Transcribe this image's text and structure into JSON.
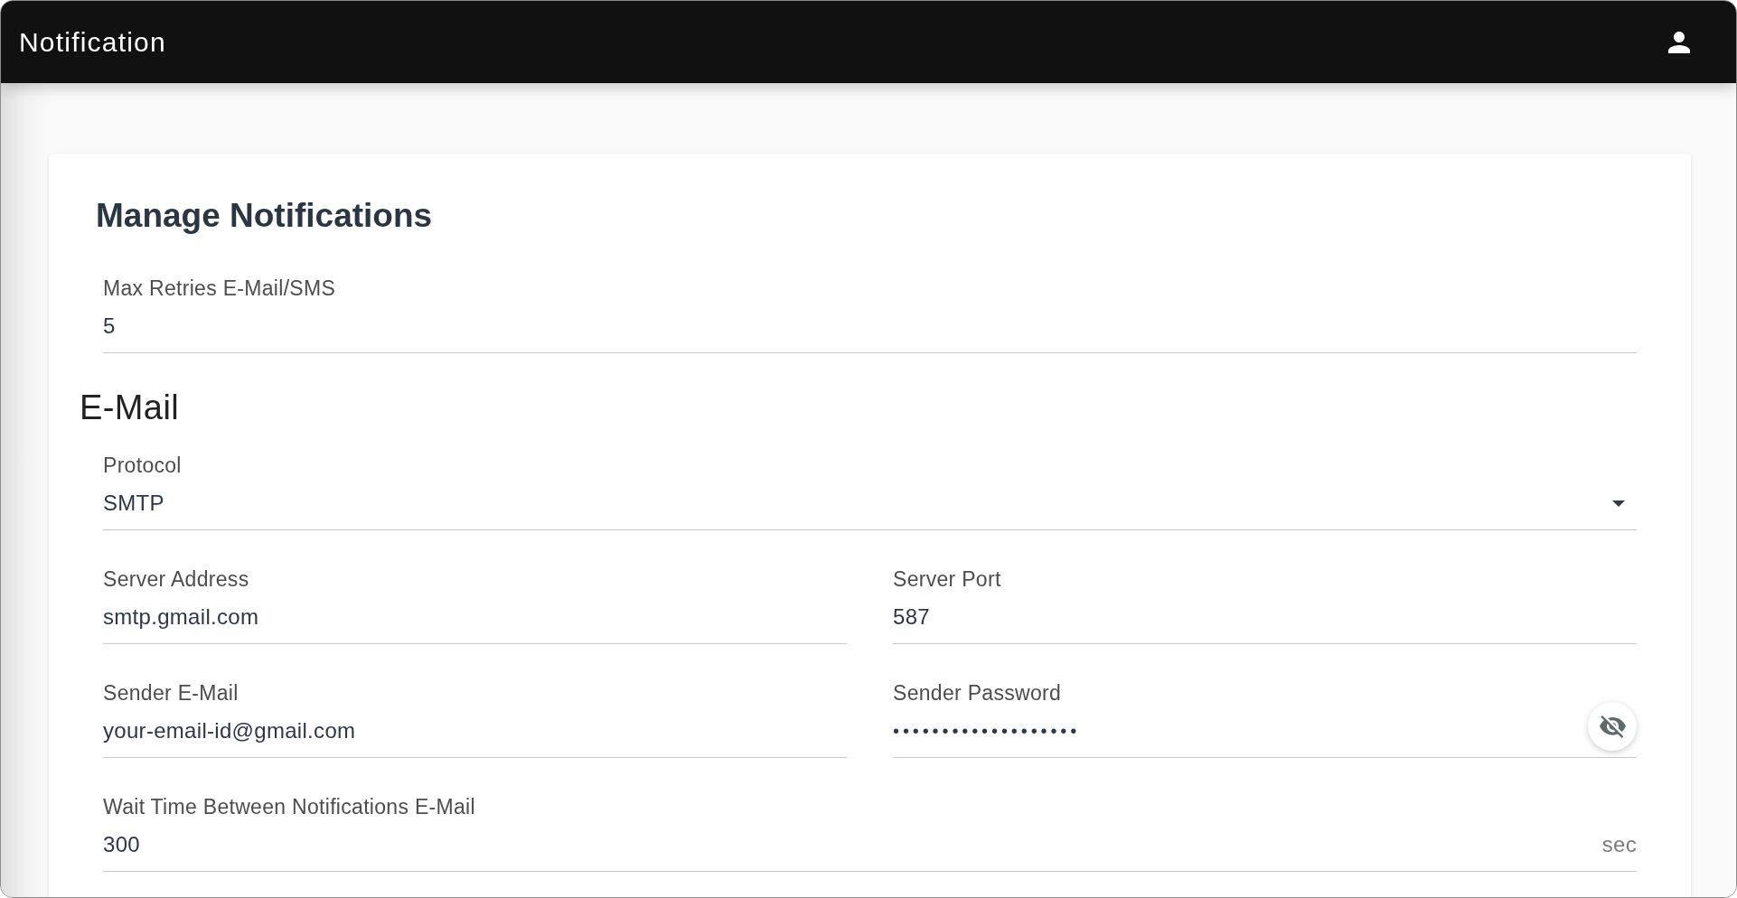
{
  "app_bar": {
    "title": "Notification"
  },
  "card": {
    "title": "Manage Notifications",
    "fields": [
      {
        "kind": "text",
        "label": "Max Retries E-Mail/SMS",
        "value": "5"
      }
    ],
    "sections": [
      {
        "title": "E-Mail",
        "rows": [
          {
            "fields": [
              {
                "kind": "select",
                "label": "Protocol",
                "value": "SMTP"
              }
            ]
          },
          {
            "fields": [
              {
                "kind": "text",
                "label": "Server Address",
                "value": "smtp.gmail.com"
              },
              {
                "kind": "text",
                "label": "Server Port",
                "value": "587"
              }
            ]
          },
          {
            "fields": [
              {
                "kind": "text",
                "label": "Sender E-Mail",
                "value": "your-email-id@gmail.com"
              },
              {
                "kind": "password",
                "label": "Sender Password",
                "value": "•••••••••••••••••••",
                "masked": true
              }
            ]
          },
          {
            "fields": [
              {
                "kind": "text",
                "label": "Wait Time Between Notifications E-Mail",
                "value": "300",
                "suffix": "sec"
              }
            ]
          }
        ]
      }
    ]
  }
}
